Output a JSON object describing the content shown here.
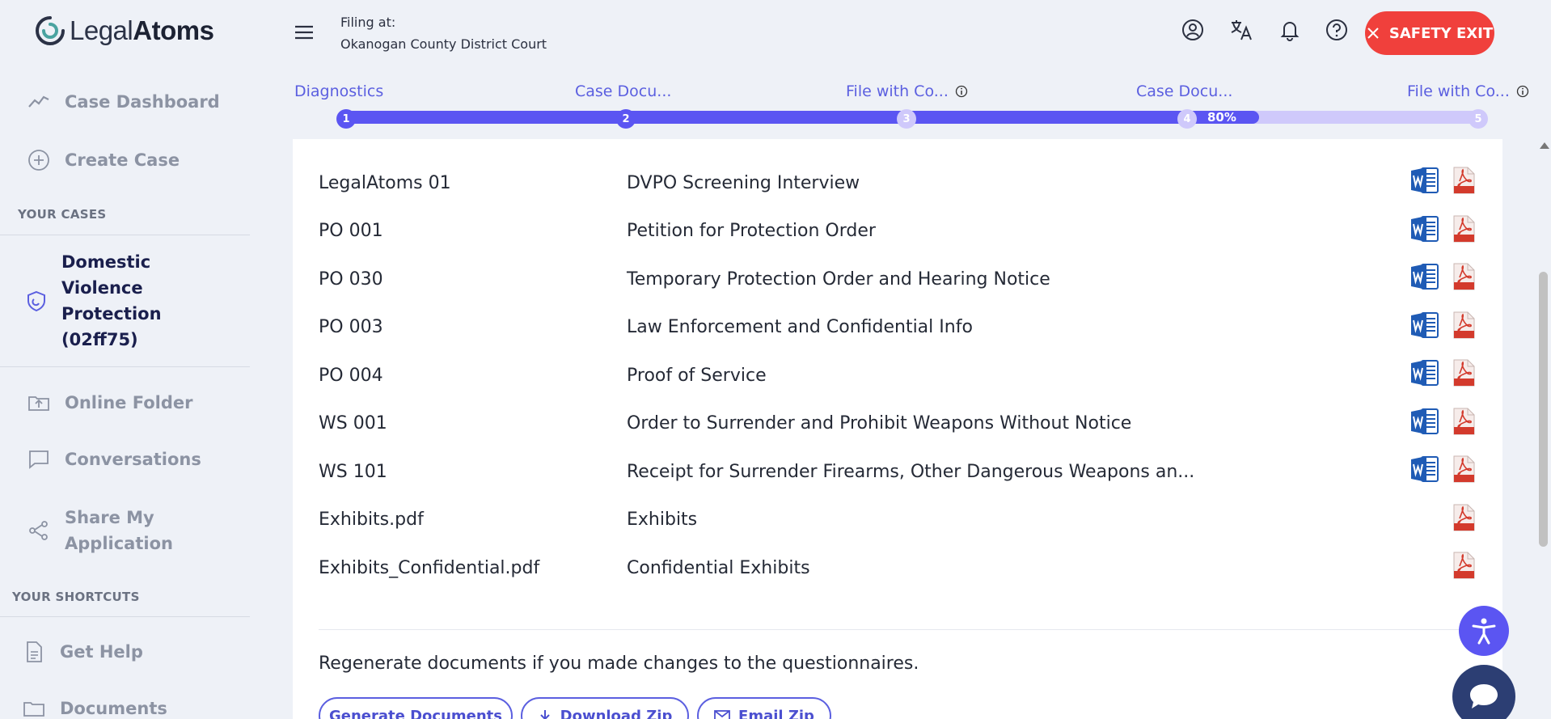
{
  "logo": {
    "text_regular": "Legal",
    "text_bold": "Atoms"
  },
  "sidebar": {
    "nav_top": [
      {
        "label": "Case Dashboard",
        "icon": "chart-line-icon"
      },
      {
        "label": "Create Case",
        "icon": "plus-circle-icon"
      }
    ],
    "your_cases_heading": "YOUR CASES",
    "active_case": {
      "label": "Domestic Violence Protection (02ff75)",
      "icon": "shield-icon"
    },
    "nav_bottom": [
      {
        "label": "Online Folder",
        "icon": "folder-upload-icon"
      },
      {
        "label": "Conversations",
        "icon": "chat-bubble-icon"
      },
      {
        "label": "Share My Application",
        "icon": "share-icon"
      }
    ],
    "shortcuts_heading": "YOUR SHORTCUTS",
    "shortcuts": [
      {
        "label": "Get Help",
        "icon": "document-icon"
      },
      {
        "label": "Documents",
        "icon": "folder-icon"
      }
    ]
  },
  "header": {
    "filing_label": "Filing at:",
    "court_name": "Okanogan County District Court",
    "safety_exit": "SAFETY EXIT"
  },
  "stepper": {
    "steps": [
      {
        "num": "1",
        "label": "Diagnostics",
        "info": false,
        "done": true
      },
      {
        "num": "2",
        "label": "Case Docu...",
        "info": false,
        "done": true
      },
      {
        "num": "3",
        "label": "File with Co...",
        "info": true,
        "done": false
      },
      {
        "num": "4",
        "label": "Case Docu...",
        "info": false,
        "done": false
      },
      {
        "num": "5",
        "label": "File with Co...",
        "info": true,
        "done": false
      }
    ],
    "progress_label": "80%",
    "progress_value": 0.8
  },
  "documents": [
    {
      "code": "LegalAtoms 01",
      "title": "DVPO Screening Interview",
      "word": true,
      "pdf": true
    },
    {
      "code": "PO 001",
      "title": "Petition for Protection Order",
      "word": true,
      "pdf": true
    },
    {
      "code": "PO 030",
      "title": "Temporary Protection Order and Hearing Notice",
      "word": true,
      "pdf": true
    },
    {
      "code": "PO 003",
      "title": "Law Enforcement and Confidential Info",
      "word": true,
      "pdf": true
    },
    {
      "code": "PO 004",
      "title": "Proof of Service",
      "word": true,
      "pdf": true
    },
    {
      "code": "WS 001",
      "title": "Order to Surrender and Prohibit Weapons Without Notice",
      "word": true,
      "pdf": true
    },
    {
      "code": "WS 101",
      "title": "Receipt for Surrender Firearms, Other Dangerous Weapons an...",
      "word": true,
      "pdf": true
    },
    {
      "code": "Exhibits.pdf",
      "title": "Exhibits",
      "word": false,
      "pdf": true
    },
    {
      "code": "Exhibits_Confidential.pdf",
      "title": "Confidential Exhibits",
      "word": false,
      "pdf": true
    }
  ],
  "regen_text": "Regenerate documents if you made changes to the questionnaires.",
  "buttons": {
    "generate": "Generate Documents",
    "download": "Download Zip",
    "email": "Email Zip"
  },
  "colors": {
    "accent": "#5b55f2",
    "danger": "#f0403c",
    "word_blue": "#1f5bb5",
    "pdf_red": "#d33a2c"
  }
}
